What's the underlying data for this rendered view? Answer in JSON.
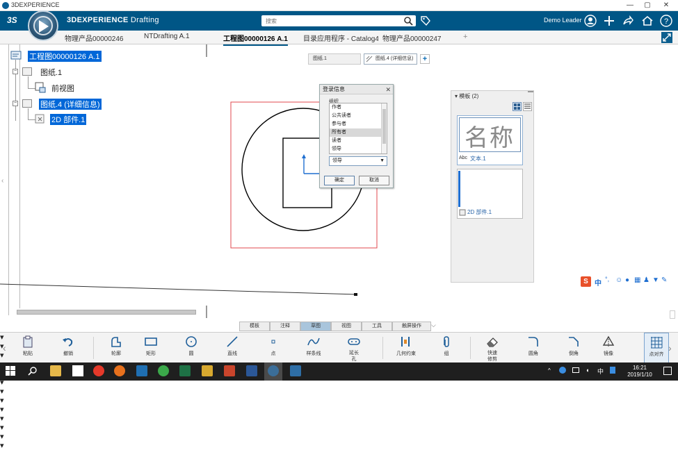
{
  "window": {
    "title": "3DEXPERIENCE"
  },
  "header": {
    "brand_strong": "3DEXPERIENCE",
    "brand_app": " Drafting",
    "search_placeholder": "搜索",
    "user": "Demo Leader"
  },
  "tabs": [
    {
      "label": "物理产品00000246"
    },
    {
      "label": "NTDrafting A.1"
    },
    {
      "label": "工程图00000126 A.1"
    },
    {
      "label": "目录应用程序 - Catalog4"
    },
    {
      "label": "物理产品00000247"
    }
  ],
  "tree": {
    "root": "工程图00000126 A.1",
    "sheet1": "图纸.1",
    "front_view": "前视图",
    "sheet4": "图纸.4 (详细信息)",
    "part2d": "2D 部件.1"
  },
  "sheet_tabs": [
    {
      "label": "图纸.1"
    },
    {
      "label": "图纸.4 (详细信息)"
    }
  ],
  "dialog": {
    "title": "登录信息",
    "group_label": "组织",
    "items": [
      "作者",
      "公共读者",
      "参与者",
      "所有者",
      "读者",
      "领导"
    ],
    "selected_item": "所有者",
    "combo_value": "领导",
    "ok": "确定",
    "cancel": "取消"
  },
  "template_panel": {
    "title": "模板 (2)",
    "card1_preview": "名称",
    "card1_label": "文本.1",
    "card2_label": "2D 部件.1"
  },
  "ime": {
    "lang": "中",
    "punct": "°,"
  },
  "section_tabs": [
    "模板",
    "注释",
    "草图",
    "视图",
    "工具",
    "触屏操作"
  ],
  "active_section": "草图",
  "actions": [
    {
      "label": "粘贴",
      "icon": "clipboard-icon"
    },
    {
      "label": "撤销",
      "icon": "undo-icon"
    },
    {
      "label": "轮廓",
      "icon": "profile-icon"
    },
    {
      "label": "矩形",
      "icon": "rectangle-icon"
    },
    {
      "label": "圆",
      "icon": "circle-icon"
    },
    {
      "label": "直线",
      "icon": "line-icon"
    },
    {
      "label": "点",
      "icon": "point-icon"
    },
    {
      "label": "样条线",
      "icon": "spline-icon"
    },
    {
      "label": "延长孔",
      "icon": "slot-icon"
    },
    {
      "label": "几何约束",
      "icon": "constraint-icon"
    },
    {
      "label": "组",
      "icon": "paperclip-icon"
    },
    {
      "label": "快速修剪",
      "icon": "eraser-icon"
    },
    {
      "label": "圆角",
      "icon": "fillet-icon"
    },
    {
      "label": "倒角",
      "icon": "chamfer-icon"
    },
    {
      "label": "镜像",
      "icon": "mirror-icon"
    },
    {
      "label": "点对齐",
      "icon": "grid-snap-icon"
    }
  ],
  "clock": {
    "time": "16:21",
    "date": "2019/1/10"
  },
  "colors": {
    "header_bg": "#005686",
    "selection": "#0067d8",
    "frame_red": "#e0474c",
    "axis_blue": "#1f6fd1"
  }
}
